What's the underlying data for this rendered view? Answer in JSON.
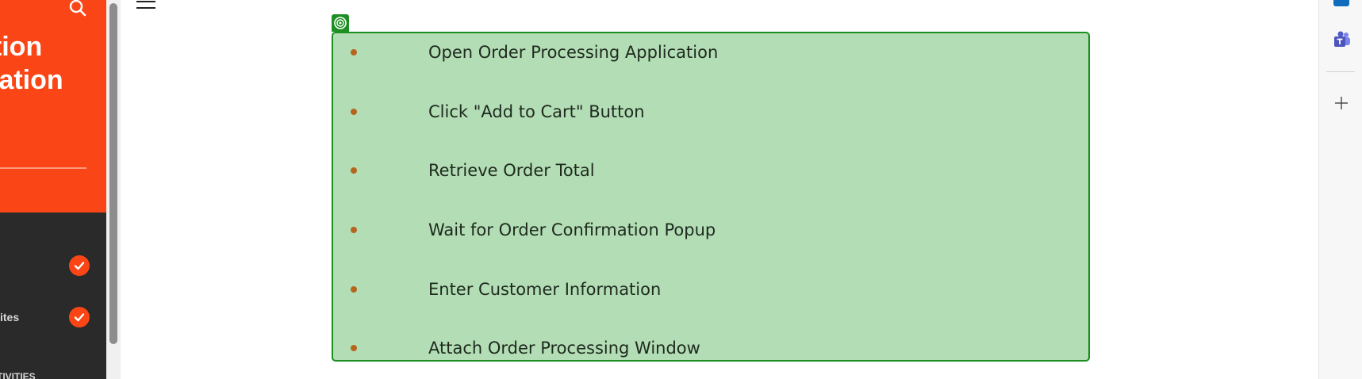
{
  "sidebar": {
    "course_title": "ation\nization\no",
    "lessons": [
      {
        "label": "",
        "completed": true
      },
      {
        "label": "ites",
        "completed": true
      }
    ],
    "section_label": "TIVITIES"
  },
  "steps": [
    "Open Order Processing Application",
    "Click \"Add to Cart\" Button",
    "Retrieve Order Total",
    "Wait for Order Confirmation Popup",
    "Enter Customer Information",
    "Attach Order Processing Window"
  ],
  "icons": {
    "search": "search-icon",
    "menu": "hamburger-menu-icon",
    "block_handle": "target-icon",
    "check": "check-icon",
    "outlook": "outlook-icon",
    "teams": "teams-icon",
    "add": "plus-icon"
  },
  "colors": {
    "accent": "#fa4616",
    "sidebar_dark": "#2a2a2a",
    "block_fill": "#b3ddb5",
    "block_border": "#1a8e1f",
    "bullet": "#b5651d"
  }
}
